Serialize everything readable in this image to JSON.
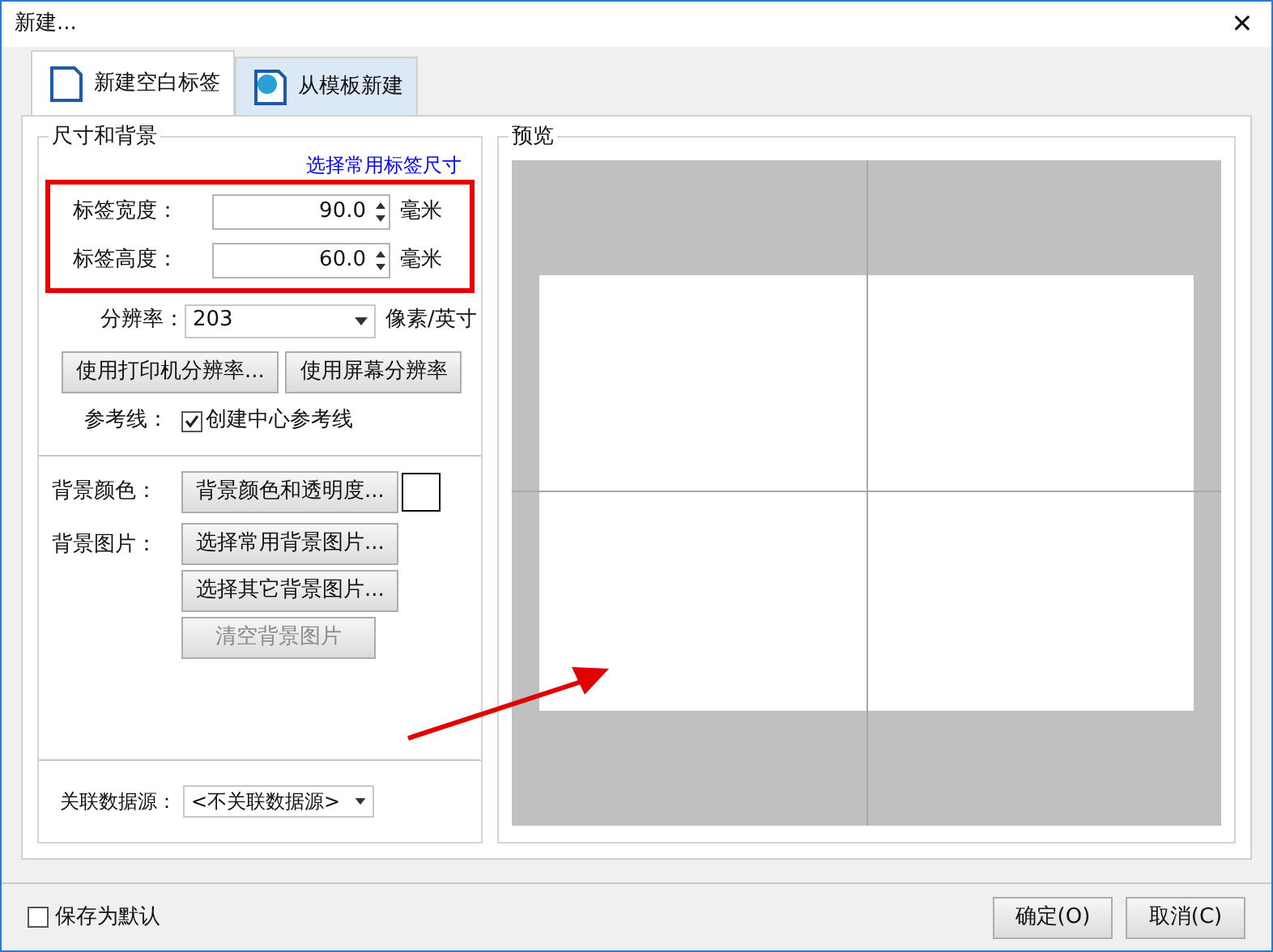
{
  "window": {
    "title": "新建...",
    "close": "✕"
  },
  "tabs": [
    {
      "label": "新建空白标签",
      "selected": true
    },
    {
      "label": "从模板新建",
      "selected": false
    }
  ],
  "size_group": {
    "title": "尺寸和背景",
    "preset_link": "选择常用标签尺寸",
    "width": {
      "label": "标签宽度：",
      "value": "90.0",
      "unit": "毫米"
    },
    "height": {
      "label": "标签高度：",
      "value": "60.0",
      "unit": "毫米"
    },
    "resolution": {
      "label": "分辨率：",
      "value": "203",
      "unit": "像素/英寸"
    },
    "resolution_buttons": [
      "使用打印机分辨率...",
      "使用屏幕分辨率"
    ],
    "guides": {
      "label": "参考线：",
      "checkbox": "创建中心参考线",
      "checked": true
    },
    "bg_color": {
      "label": "背景颜色：",
      "button": "背景颜色和透明度...",
      "color": "#ffffff"
    },
    "bg_image": {
      "label": "背景图片：",
      "buttons": [
        {
          "label": "选择常用背景图片...",
          "disabled": false
        },
        {
          "label": "选择其它背景图片...",
          "disabled": false
        },
        {
          "label": "清空背景图片",
          "disabled": true
        }
      ]
    },
    "datasource": {
      "label": "关联数据源：",
      "value": "<不关联数据源>"
    }
  },
  "preview": {
    "title": "预览"
  },
  "footer": {
    "checkbox": "保存为默认",
    "checked": false,
    "buttons": [
      "确定(O)",
      "取消(C)"
    ]
  }
}
